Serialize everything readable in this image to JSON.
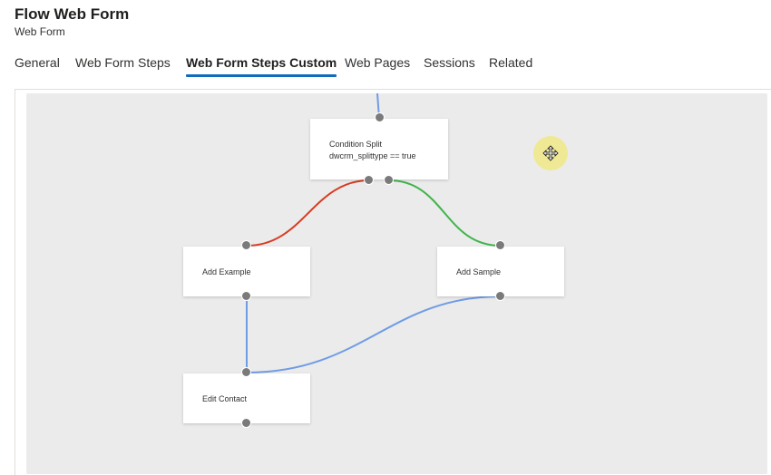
{
  "header": {
    "title": "Flow Web Form",
    "subtitle": "Web Form"
  },
  "tabs": [
    {
      "label": "General",
      "active": false
    },
    {
      "label": "Web Form Steps",
      "active": false
    },
    {
      "label": "Web Form Steps Custom",
      "active": true
    },
    {
      "label": "Web Pages",
      "active": false
    },
    {
      "label": "Sessions",
      "active": false
    },
    {
      "label": "Related",
      "active": false
    }
  ],
  "flow": {
    "nodes": {
      "condition": {
        "line1": "Condition Split",
        "line2": "dwcrm_splittype == true"
      },
      "add_example": {
        "label": "Add Example"
      },
      "add_sample": {
        "label": "Add Sample"
      },
      "edit_contact": {
        "label": "Edit Contact"
      }
    },
    "connections": [
      {
        "from": "entry",
        "to": "condition",
        "color": "#6f9ce6"
      },
      {
        "from": "condition",
        "to": "add_example",
        "color": "#d93a21",
        "meaning": "false-branch"
      },
      {
        "from": "condition",
        "to": "add_sample",
        "color": "#3fb44a",
        "meaning": "true-branch"
      },
      {
        "from": "add_example",
        "to": "edit_contact",
        "color": "#6f9ce6"
      },
      {
        "from": "add_sample",
        "to": "edit_contact",
        "color": "#6f9ce6"
      }
    ]
  },
  "colors": {
    "accent": "#0f6cbd",
    "canvas": "#ebebeb",
    "port": "#7a7a7a",
    "cursor_highlight": "#f0e878"
  },
  "icons": {
    "cursor": "move-cursor-icon"
  }
}
